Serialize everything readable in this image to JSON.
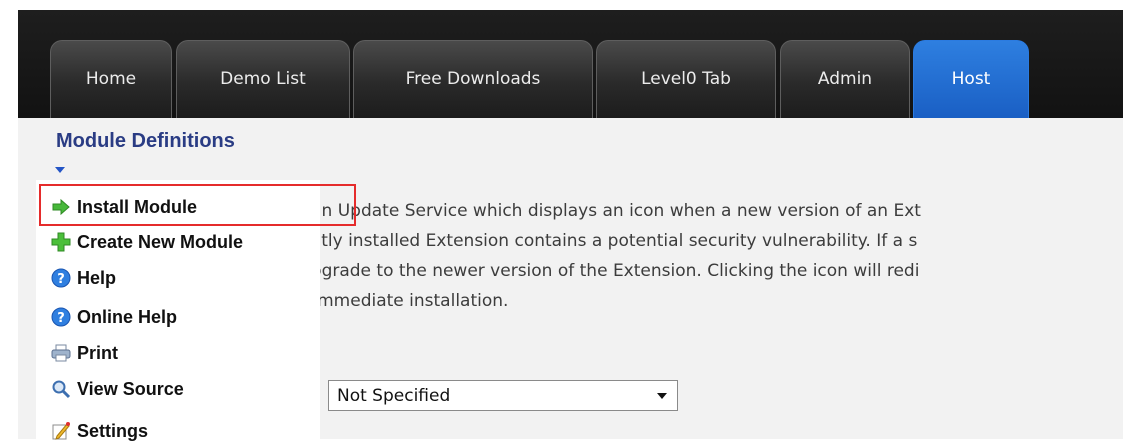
{
  "nav": {
    "tabs": [
      {
        "label": "Home"
      },
      {
        "label": "Demo List"
      },
      {
        "label": "Free Downloads"
      },
      {
        "label": "Level0 Tab"
      },
      {
        "label": "Admin"
      },
      {
        "label": "Host",
        "active": true
      }
    ]
  },
  "module": {
    "title": "Module Definitions"
  },
  "action_menu": {
    "items": [
      {
        "label": "Install Module",
        "icon": "arrow-right-icon",
        "highlighted": true
      },
      {
        "label": "Create New Module",
        "icon": "plus-icon"
      },
      {
        "label": "Help",
        "icon": "help-icon"
      },
      {
        "label": "Online Help",
        "icon": "online-help-icon"
      },
      {
        "label": "Print",
        "icon": "print-icon"
      },
      {
        "label": "View Source",
        "icon": "view-source-icon"
      },
      {
        "label": "Settings",
        "icon": "settings-icon"
      }
    ]
  },
  "description": {
    "lines": [
      ": an Update Service which displays an icon when a new version of an Ext",
      "ently installed Extension contains a potential security vulnerability. If a s",
      "upgrade to the newer version of the Extension. Clicking the icon will redi",
      "r immediate installation."
    ]
  },
  "filter": {
    "selected": "Not Specified"
  },
  "colors": {
    "active_tab": "#2b7be0",
    "title": "#2a3c84",
    "highlight_border": "#e52b2b"
  }
}
